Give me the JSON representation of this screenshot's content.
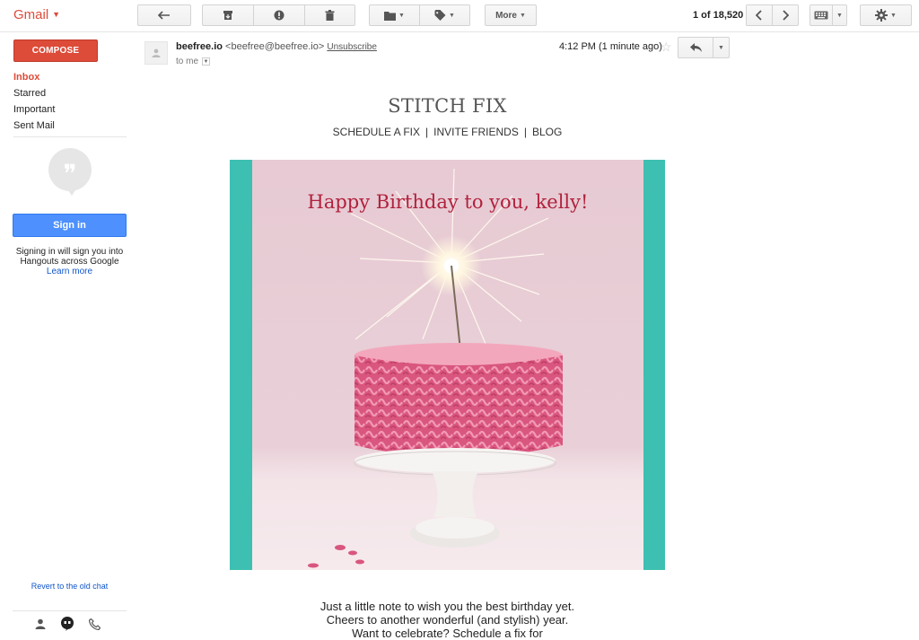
{
  "app": {
    "brand": "Gmail"
  },
  "toolbar": {
    "more_label": "More",
    "pager_range": "1 of 18,520"
  },
  "sidebar": {
    "compose_label": "COMPOSE",
    "items": [
      {
        "label": "Inbox",
        "active": true
      },
      {
        "label": "Starred"
      },
      {
        "label": "Important"
      },
      {
        "label": "Sent Mail"
      }
    ],
    "signin_label": "Sign in",
    "signin_note": "Signing in will sign you into Hangouts across Google",
    "learn_more": "Learn more",
    "revert_chat": "Revert to the old chat"
  },
  "email": {
    "sender_name": "beefree.io",
    "sender_address": "<beefree@beefree.io>",
    "unsubscribe": "Unsubscribe",
    "to": "to me",
    "time": "4:12 PM (1 minute ago)"
  },
  "content": {
    "brand_title": "STITCH FIX",
    "menu": [
      "SCHEDULE A FIX",
      "INVITE FRIENDS",
      "BLOG"
    ],
    "menu_separator": "|",
    "greeting": "Happy Birthday to you, kelly!",
    "body_lines": [
      "Just a little note to wish you the best birthday yet.",
      "Cheers to another wonderful (and stylish) year.",
      "Want to celebrate? Schedule a fix for"
    ]
  },
  "colors": {
    "accent_red": "#dd4b39",
    "signin_blue": "#4d90fe",
    "teal_border": "#3dbfb2",
    "greeting_red": "#b0213d"
  }
}
